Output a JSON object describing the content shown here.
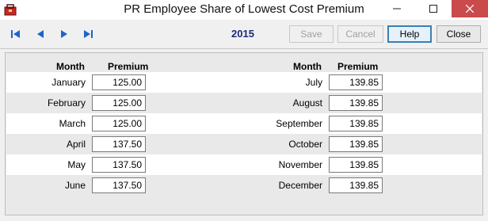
{
  "window": {
    "title": "PR Employee Share of Lowest Cost Premium"
  },
  "toolbar": {
    "year": "2015",
    "save_label": "Save",
    "cancel_label": "Cancel",
    "help_label": "Help",
    "close_label": "Close"
  },
  "columns": {
    "month_header": "Month",
    "premium_header": "Premium"
  },
  "left_months": [
    {
      "month": "January",
      "premium": "125.00"
    },
    {
      "month": "February",
      "premium": "125.00"
    },
    {
      "month": "March",
      "premium": "125.00"
    },
    {
      "month": "April",
      "premium": "137.50"
    },
    {
      "month": "May",
      "premium": "137.50"
    },
    {
      "month": "June",
      "premium": "137.50"
    }
  ],
  "right_months": [
    {
      "month": "July",
      "premium": "139.85"
    },
    {
      "month": "August",
      "premium": "139.85"
    },
    {
      "month": "September",
      "premium": "139.85"
    },
    {
      "month": "October",
      "premium": "139.85"
    },
    {
      "month": "November",
      "premium": "139.85"
    },
    {
      "month": "December",
      "premium": "139.85"
    }
  ]
}
